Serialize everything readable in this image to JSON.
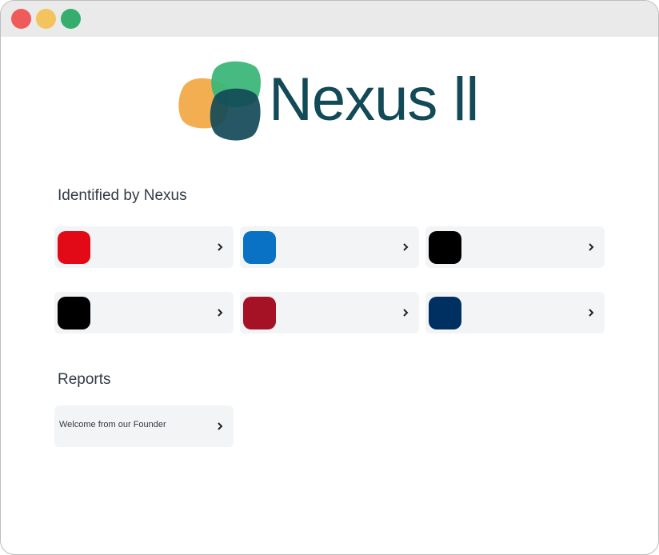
{
  "window": {
    "traffic_lights": [
      {
        "name": "close",
        "color": "#ef5b5b"
      },
      {
        "name": "minimize",
        "color": "#f3c35d"
      },
      {
        "name": "zoom",
        "color": "#34ad6d"
      }
    ]
  },
  "header": {
    "brand": "Nexus ll",
    "logo_colors": [
      "#f2a33a",
      "#3cb679",
      "#124a57"
    ]
  },
  "identified": {
    "title": "Identified by Nexus",
    "items": [
      {
        "color": "#e20a17",
        "icon": "chevron-right-icon"
      },
      {
        "color": "#0a72c4",
        "icon": "chevron-right-icon"
      },
      {
        "color": "#000000",
        "icon": "chevron-right-icon"
      },
      {
        "color": "#000000",
        "icon": "chevron-right-icon"
      },
      {
        "color": "#a51226",
        "icon": "chevron-right-icon"
      },
      {
        "color": "#002f62",
        "icon": "chevron-right-icon"
      }
    ]
  },
  "reports": {
    "title": "Reports",
    "items": [
      {
        "label": "Welcome from our Founder",
        "icon": "chevron-right-icon"
      }
    ]
  }
}
